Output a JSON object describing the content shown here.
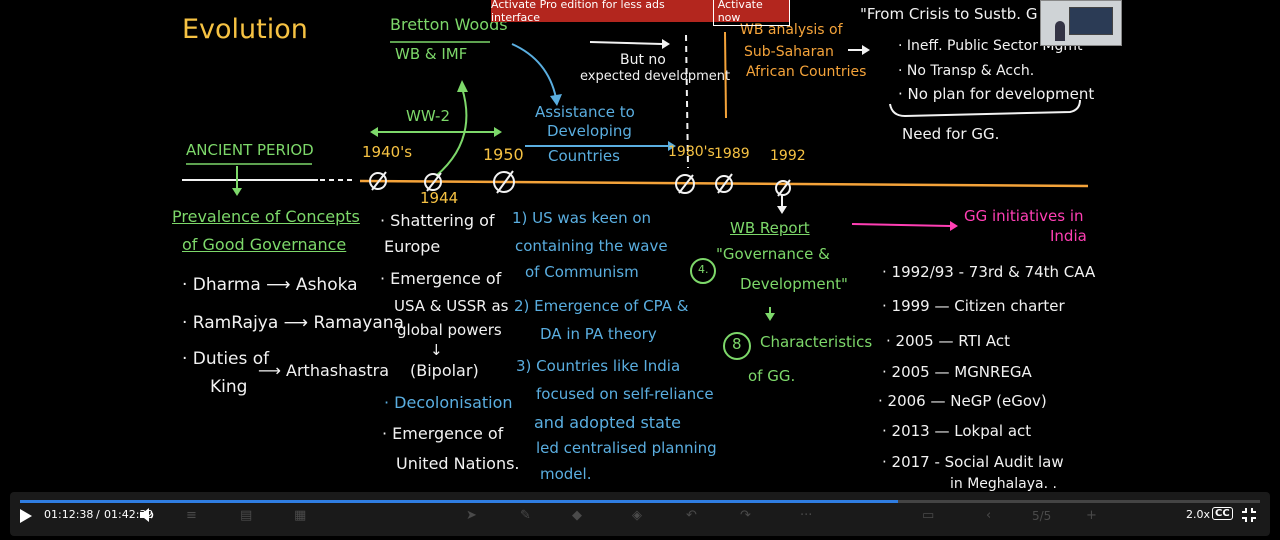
{
  "ads": {
    "message": "Activate Pro edition for less ads interface",
    "button": "Activate now"
  },
  "board": {
    "title": "Evolution",
    "bretton": {
      "title": "Bretton Woods",
      "sub": "WB & IMF"
    },
    "ww2": "WW-2",
    "ancient": "ANCIENT PERIOD",
    "years": {
      "y1940s": "1940's",
      "y1944": "1944",
      "y1950": "1950",
      "y1980s": "1980's",
      "y1989": "1989",
      "y1992": "1992"
    },
    "assistance": [
      "Assistance to",
      "Developing",
      "Countries"
    ],
    "butno": [
      "But no",
      "expected development"
    ],
    "wbanalysis": [
      "WB analysis of",
      "Sub-Saharan",
      "African Countries"
    ],
    "crisis": "\"From Crisis to Sustb. G",
    "crisis_points": [
      "· Ineff. Public Sector Mgmt",
      "· No Transp & Acch.",
      "· No plan for development"
    ],
    "need_gg": "Need for GG.",
    "prevalence": [
      "Prevalence of Concepts",
      "of Good Governance"
    ],
    "ancient_items": [
      "· Dharma ⟶ Ashoka",
      "· RamRajya ⟶ Ramayana",
      "· Duties of",
      "King",
      "⟶ Arthashastra"
    ],
    "ww2_items": [
      "· Shattering of",
      "Europe",
      "· Emergence of",
      "USA & USSR as",
      "global powers",
      "↓",
      "(Bipolar)",
      "· Decolonisation",
      "· Emergence of",
      "United Nations."
    ],
    "reasons": [
      "1) US was keen on",
      "containing the wave",
      "of Communism",
      "2) Emergence of CPA &",
      "DA in PA theory",
      "3) Countries like India",
      "focused on self-reliance",
      "and adopted state",
      "led centralised planning",
      "model."
    ],
    "wbreport": [
      "WB Report",
      "\"Governance &",
      "Development\"",
      "↓",
      "Characteristics",
      "of GG."
    ],
    "wb_num1": "4.",
    "wb_num2": "8",
    "gg_india": [
      "GG initiatives in",
      "India"
    ],
    "initiatives": [
      "· 1992/93 - 73rd & 74th CAA",
      "· 1999 — Citizen charter",
      "· 2005 — RTI Act",
      "· 2005 — MGNREGA",
      "· 2006 — NeGP (eGov)",
      "· 2013 — Lokpal act",
      "· 2017 - Social Audit law",
      "in Meghalaya. ."
    ]
  },
  "player": {
    "time_current": "01:12:38",
    "time_sep": "/",
    "time_total": "01:42:32",
    "progress": 0.708,
    "speed": "2.0x",
    "cc": "CC",
    "page": "5/5",
    "play_icon": "play-icon",
    "volume_icon": "volume-icon",
    "fullscreen_icon": "exit-fullscreen-icon"
  },
  "colors": {
    "timeline": "#f4a33a",
    "progress": "#2f7de1",
    "ads": "#b3261e"
  }
}
